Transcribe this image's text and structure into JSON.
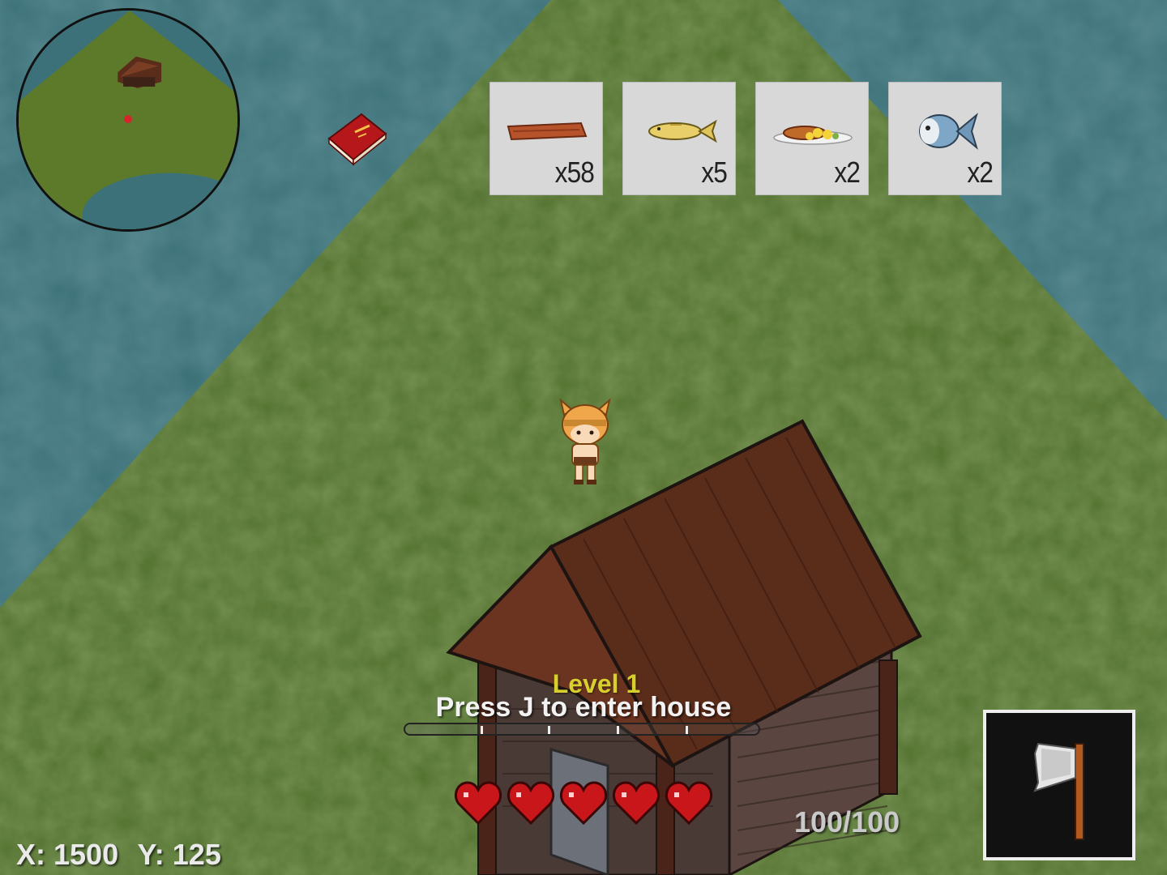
{
  "world": {
    "position": {
      "x_label": "X: 1500",
      "y_label": "Y: 125"
    }
  },
  "hud": {
    "level_label": "Level 1",
    "prompt_label": "Press J to enter house",
    "xp_fraction": 0.0,
    "health_label": "100/100",
    "hearts": [
      1,
      1,
      1,
      1,
      1
    ],
    "equipped_tool": "axe-icon"
  },
  "inventory": {
    "slots": [
      {
        "item": "wood-plank-icon",
        "count": "x58"
      },
      {
        "item": "yellow-fish-icon",
        "count": "x5"
      },
      {
        "item": "cooked-meal-icon",
        "count": "x2"
      },
      {
        "item": "blue-fish-icon",
        "count": "x2"
      }
    ]
  },
  "colors": {
    "grass": "#4f6b2e",
    "water": "#3b7077",
    "level_text": "#d7cf2e",
    "heart": "#c8161a",
    "inventory_slot": "#d8d8d8",
    "roof": "#5a2c1a"
  }
}
